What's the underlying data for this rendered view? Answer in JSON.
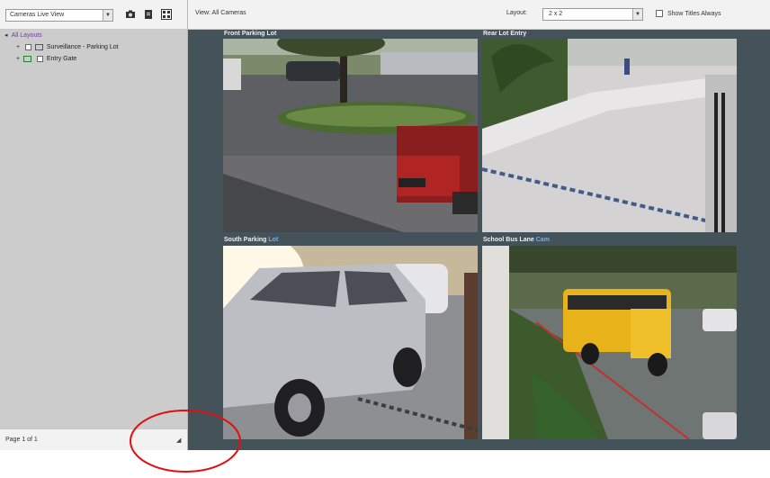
{
  "left_panel": {
    "toolbar": {
      "selector_value": "Cameras Live View",
      "icons": [
        "camera-icon",
        "document-icon",
        "grid-icon"
      ]
    },
    "tree": [
      {
        "label": "All Layouts",
        "expanded": true
      },
      {
        "label": "Surveillance - Parking Lot",
        "icon": "camera-group-icon"
      },
      {
        "label": "Entry Gate",
        "icon": "map-icon"
      }
    ],
    "status_text": "Page 1 of 1"
  },
  "toolbar": {
    "view_label": "View: All Cameras",
    "layout_label": "Layout:",
    "layout_value": "2 x 2",
    "checkbox_label": "Show Titles Always",
    "checkbox_checked": false
  },
  "cameras": [
    {
      "title": "Front Parking Lot",
      "accent": ""
    },
    {
      "title": "Rear Lot Entry",
      "accent": ""
    },
    {
      "title": "South Parking",
      "accent": " Lot"
    },
    {
      "title": "School Bus Lane",
      "accent": " Cam"
    }
  ],
  "annotation": {
    "color": "#e01010",
    "shape": "ellipse"
  },
  "colors": {
    "background": "#44525a",
    "panel": "#cccccc",
    "accent": "#6ab0ff"
  }
}
